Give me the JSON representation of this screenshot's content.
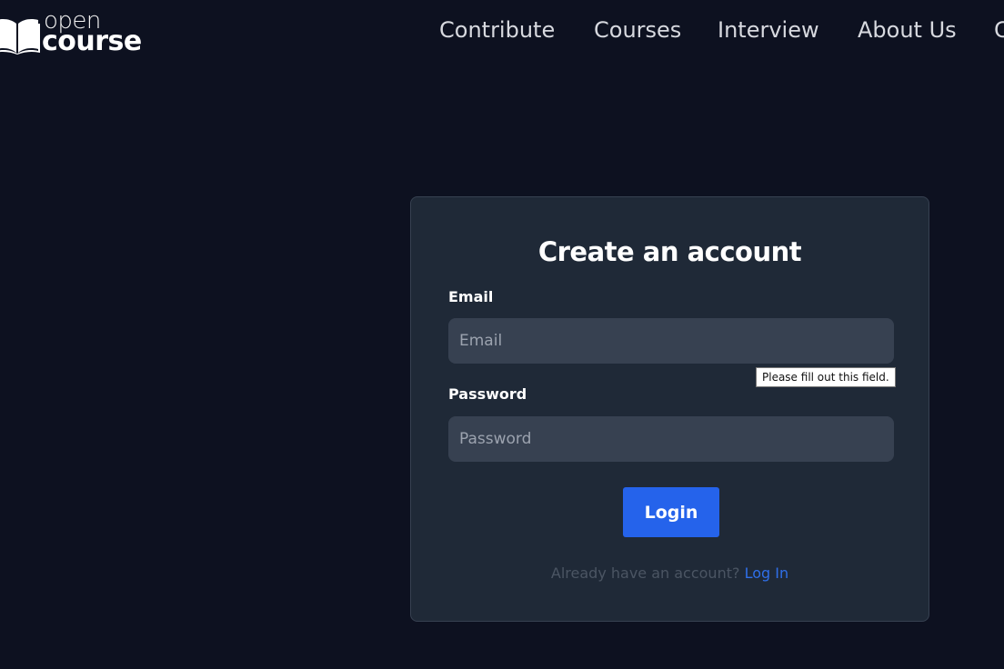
{
  "header": {
    "logo": {
      "line1": "open",
      "line2": "course",
      "icon": "open-book-icon"
    },
    "nav": [
      {
        "label": "Contribute"
      },
      {
        "label": "Courses"
      },
      {
        "label": "Interview"
      },
      {
        "label": "About Us"
      },
      {
        "label": "C"
      }
    ]
  },
  "form": {
    "title": "Create an account",
    "email": {
      "label": "Email",
      "placeholder": "Email",
      "value": ""
    },
    "password": {
      "label": "Password",
      "placeholder": "Password",
      "value": ""
    },
    "validation_tooltip": "Please fill out this field.",
    "submit_label": "Login",
    "footer_text": "Already have an account?",
    "footer_link": "Log In"
  },
  "colors": {
    "background": "#0d1120",
    "card": "#1f2937",
    "input": "#374151",
    "accent": "#2563eb",
    "link": "#2f6fe8"
  }
}
